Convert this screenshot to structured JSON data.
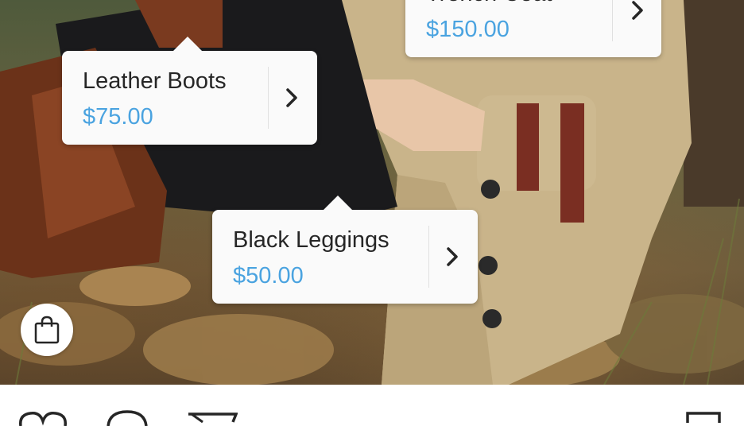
{
  "tags": [
    {
      "name": "Trench Coat",
      "price": "$150.00"
    },
    {
      "name": "Leather Boots",
      "price": "$75.00"
    },
    {
      "name": "Black Leggings",
      "price": "$50.00"
    }
  ],
  "icons": {
    "shopping_bag": "shopping-bag-icon",
    "chevron": "chevron-right-icon",
    "like": "heart-icon",
    "comment": "comment-icon",
    "share": "share-icon",
    "save": "bookmark-icon"
  },
  "colors": {
    "price": "#4aa3e0",
    "name": "#262626"
  }
}
